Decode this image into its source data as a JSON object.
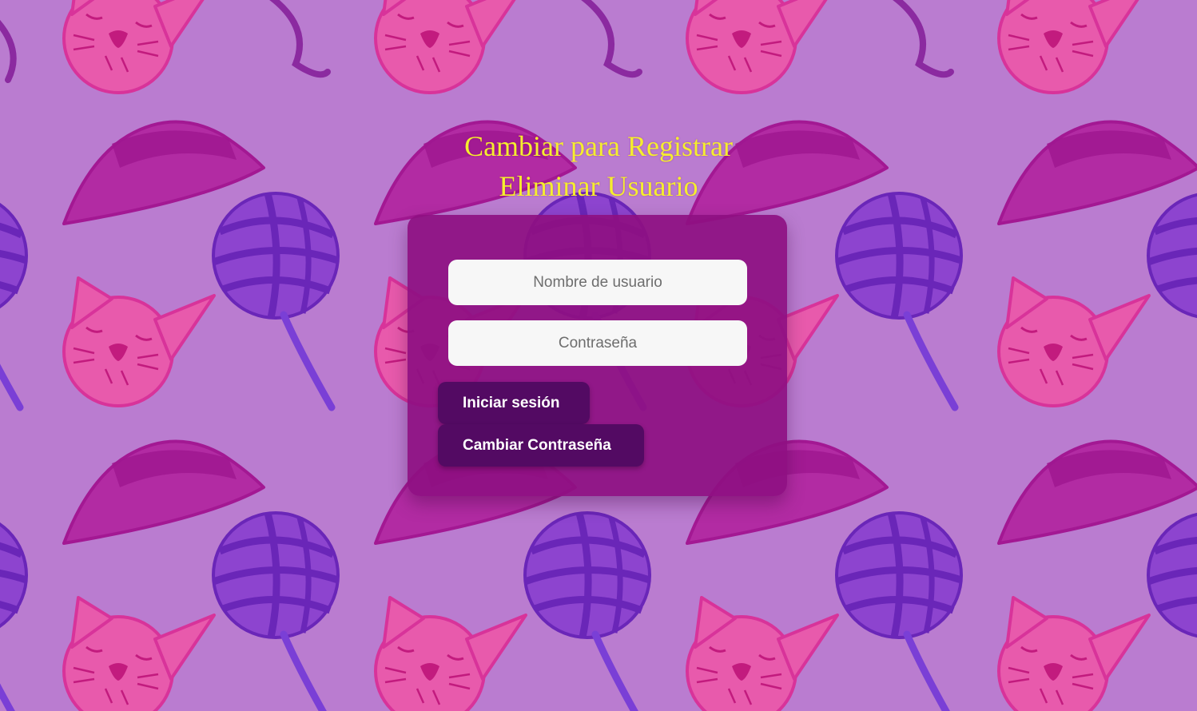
{
  "background": {
    "base_color": "#ba7cd0",
    "pattern_icons": [
      "cat-face-icon",
      "hat-icon",
      "yarn-ball-icon"
    ],
    "colors": {
      "cat": "#e94fa8",
      "hat": "#a61c98",
      "yarn": "#7a3fd6"
    }
  },
  "header": {
    "register_link": "Cambiar para Registrar",
    "delete_user_link": "Eliminar Usuario",
    "color": "#f5ee2e"
  },
  "form": {
    "username_placeholder": "Nombre de usuario",
    "username_value": "",
    "password_placeholder": "Contraseña",
    "password_value": "",
    "login_button": "Iniciar sesión",
    "change_password_button": "Cambiar Contraseña",
    "card_color": "#8e1082",
    "button_color": "#530a63"
  }
}
